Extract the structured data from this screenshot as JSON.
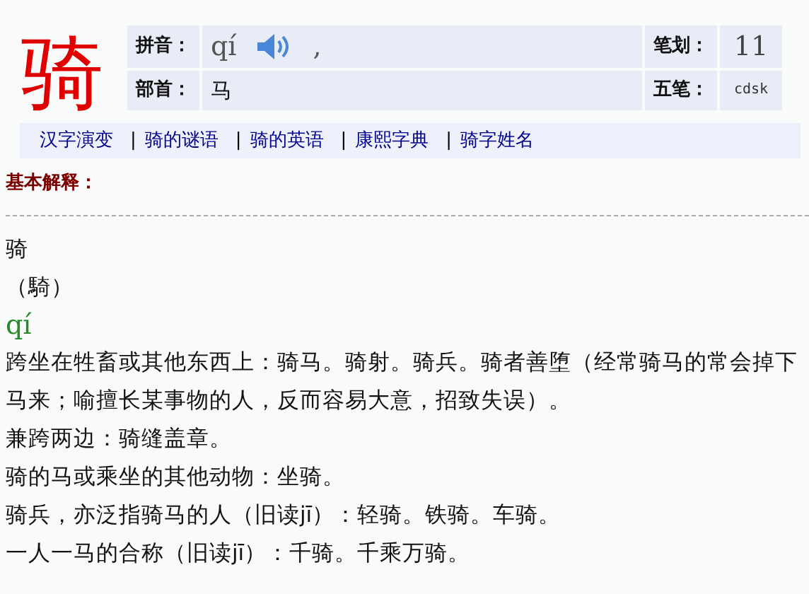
{
  "headword": "骑",
  "info": {
    "rows": [
      {
        "fields": [
          {
            "label": "拼音：",
            "value": "qí",
            "kind": "pinyin",
            "suffix": ","
          },
          {
            "label": "笔划：",
            "value": "11",
            "kind": "big"
          }
        ]
      },
      {
        "fields": [
          {
            "label": "部首：",
            "value": "马",
            "kind": "plain"
          },
          {
            "label": "五笔：",
            "value": "cdsk",
            "kind": "small"
          }
        ]
      }
    ]
  },
  "nav": [
    {
      "label": "汉字演变"
    },
    {
      "sep": "|",
      "label": "骑的谜语"
    },
    {
      "sep": "|",
      "label": "骑的英语"
    },
    {
      "sep": "|",
      "label": "康熙字典"
    },
    {
      "sep": "|",
      "label": "骑字姓名"
    }
  ],
  "section_title": "基本解释：",
  "entries": [
    {
      "kind": "char",
      "text": "骑"
    },
    {
      "kind": "trad",
      "text": "（騎）"
    },
    {
      "kind": "pinyin",
      "text": "qí"
    },
    {
      "kind": "def",
      "text": "跨坐在牲畜或其他东西上：骑马。骑射。骑兵。骑者善堕（经常骑马的常会掉下马来；喻擅长某事物的人，反而容易大意，招致失误）。"
    },
    {
      "kind": "def",
      "text": "兼跨两边：骑缝盖章。"
    },
    {
      "kind": "def",
      "text": "骑的马或乘坐的其他动物：坐骑。"
    },
    {
      "kind": "def",
      "text": "骑兵，亦泛指骑马的人（旧读jī）：轻骑。铁骑。车骑。"
    },
    {
      "kind": "def",
      "text": "一人一马的合称（旧读jī）：千骑。千乘万骑。"
    }
  ]
}
